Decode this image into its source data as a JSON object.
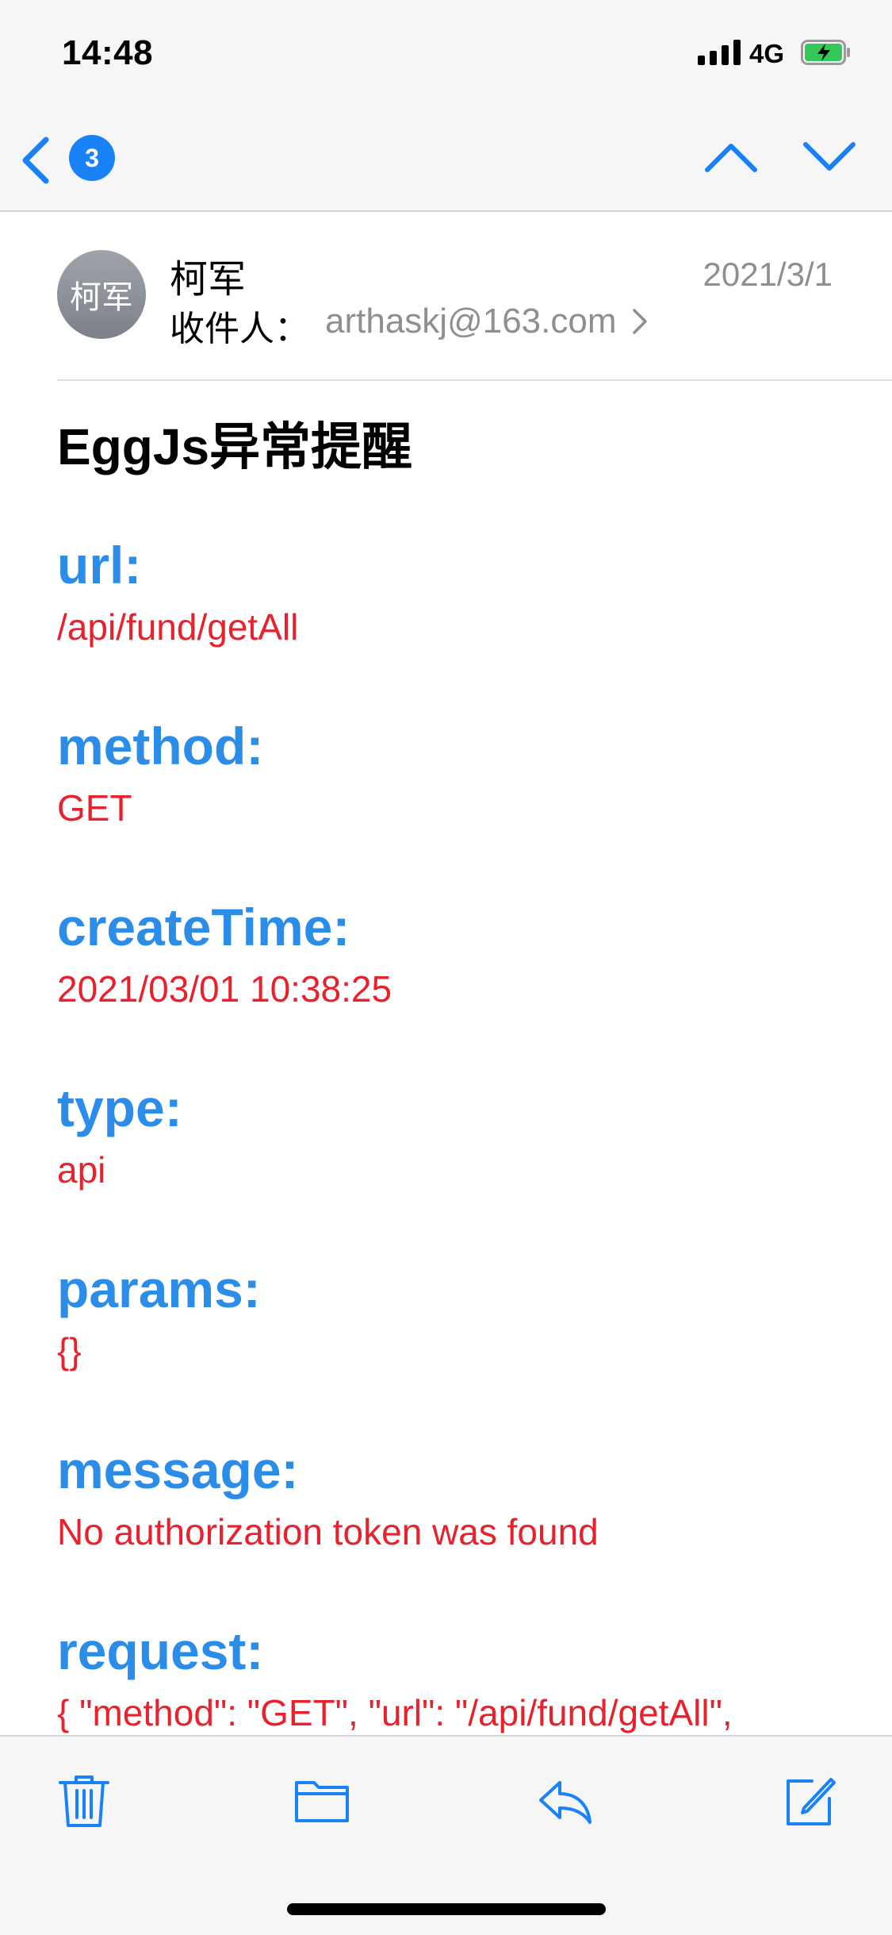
{
  "status": {
    "time": "14:48",
    "network": "4G"
  },
  "nav": {
    "unread_count": "3"
  },
  "message": {
    "avatar_initials": "柯军",
    "sender": "柯军",
    "date": "2021/3/1",
    "to_label": "收件人：",
    "to_address": "arthaskj@163.com",
    "subject": "EggJs异常提醒"
  },
  "fields": [
    {
      "label": "url:",
      "value": "/api/fund/getAll"
    },
    {
      "label": "method:",
      "value": "GET"
    },
    {
      "label": "createTime:",
      "value": "2021/03/01 10:38:25"
    },
    {
      "label": "type:",
      "value": "api"
    },
    {
      "label": "params:",
      "value": "{}"
    },
    {
      "label": "message:",
      "value": "No authorization token was found"
    },
    {
      "label": "request:",
      "value": "{ \"method\": \"GET\", \"url\": \"/api/fund/getAll\","
    }
  ],
  "icons": {
    "back": "chevron-left-icon",
    "prev": "chevron-up-icon",
    "next": "chevron-down-icon",
    "trash": "trash-icon",
    "folder": "folder-icon",
    "reply": "reply-icon",
    "compose": "compose-icon"
  },
  "colors": {
    "accent": "#1a82f7",
    "label": "#2b8de8",
    "value": "#e8222d"
  }
}
